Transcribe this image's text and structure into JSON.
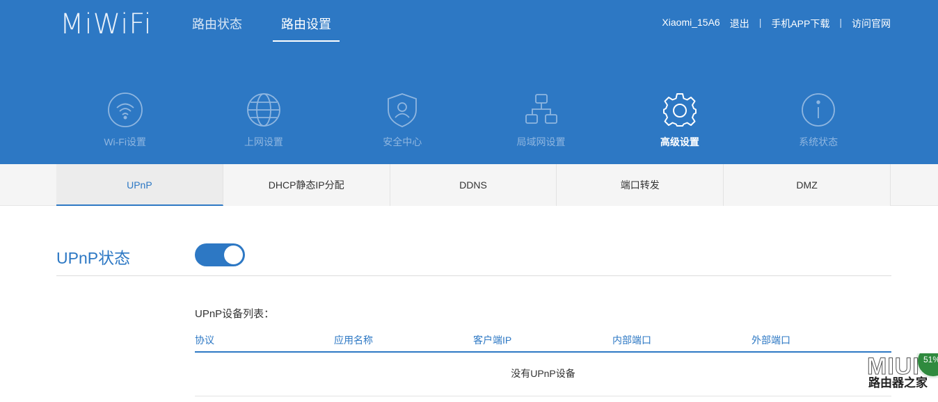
{
  "app": {
    "logo": "MiWiFi"
  },
  "topnav": {
    "items": [
      {
        "label": "路由状态"
      },
      {
        "label": "路由设置"
      }
    ]
  },
  "userbar": {
    "username": "Xiaomi_15A6",
    "logout": "退出",
    "separator": "|",
    "app_download": "手机APP下载",
    "official_site": "访问官网"
  },
  "mainmenu": {
    "items": [
      {
        "label": "Wi-Fi设置",
        "icon": "wifi-icon"
      },
      {
        "label": "上网设置",
        "icon": "globe-icon"
      },
      {
        "label": "安全中心",
        "icon": "shield-user-icon"
      },
      {
        "label": "局域网设置",
        "icon": "network-topology-icon"
      },
      {
        "label": "高级设置",
        "icon": "gear-icon"
      },
      {
        "label": "系统状态",
        "icon": "info-icon"
      }
    ],
    "active_index": 4
  },
  "tabs": {
    "items": [
      {
        "label": "UPnP"
      },
      {
        "label": "DHCP静态IP分配"
      },
      {
        "label": "DDNS"
      },
      {
        "label": "端口转发"
      },
      {
        "label": "DMZ"
      }
    ]
  },
  "upnp": {
    "status_title": "UPnP状态",
    "enabled": true,
    "list_title": "UPnP设备列表：",
    "columns": [
      "协议",
      "应用名称",
      "客户端IP",
      "内部端口",
      "外部端口"
    ],
    "rows": [],
    "empty_text": "没有UPnP设备"
  },
  "watermark": {
    "big": "MIUI",
    "cn": "路由器之家",
    "badge": "51%"
  },
  "colors": {
    "brand_blue": "#2d78c4",
    "header_text_dim": "#8fb6e0",
    "tab_bg": "#f5f5f5"
  }
}
